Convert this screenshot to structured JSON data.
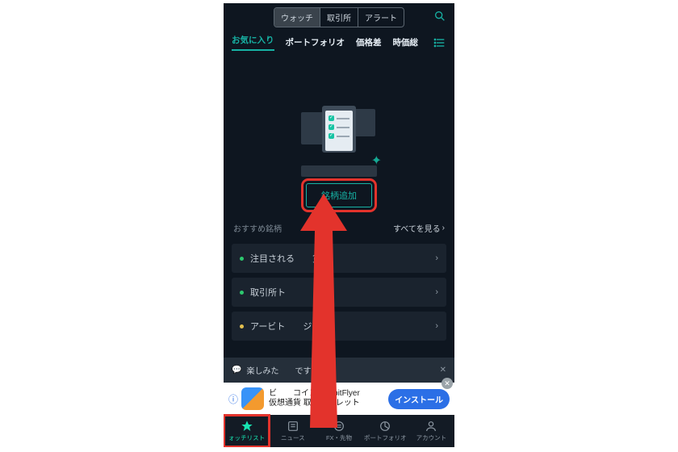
{
  "seg": {
    "watch": "ウォッチ",
    "exchange": "取引所",
    "alert": "アラート"
  },
  "tabs": {
    "fav": "お気に入り",
    "portfolio": "ポートフォリオ",
    "spread": "価格差",
    "market": "時価総"
  },
  "add_button": "銘柄追加",
  "rec": {
    "heading": "おすすめ銘柄",
    "see_all": "すべてを見る",
    "items": [
      {
        "label": "注目される　　貨"
      },
      {
        "label": "取引所ト"
      },
      {
        "label": "アービト　　ジ"
      }
    ]
  },
  "banner": {
    "text": "楽しみた　　です"
  },
  "ad": {
    "line1": "ビ　　コインならbitFlyer",
    "line2": "仮想通貨 取引ウォレット",
    "install": "インストール"
  },
  "nav": {
    "watchlist": "ォッチリスト",
    "news": "ニュース",
    "fx": "FX・先物",
    "portfolio": "ポートフォリオ",
    "account": "アカウント"
  }
}
